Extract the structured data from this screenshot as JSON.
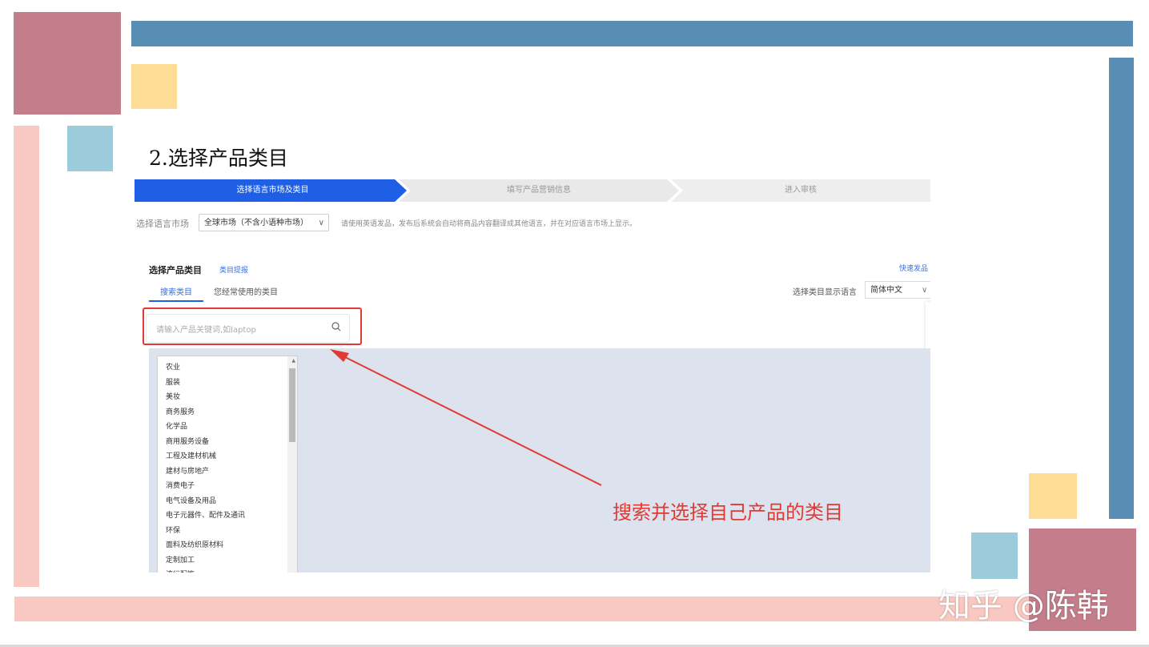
{
  "slide": {
    "heading": "2.选择产品类目",
    "annotation": "搜索并选择自己产品的类目",
    "watermark": "知乎 @陈韩"
  },
  "colors": {
    "rose": "#c47d8b",
    "steel_blue": "#588db4",
    "light_yellow": "#fddc95",
    "light_blue": "#9ccbdc",
    "light_pink": "#f9c8c1",
    "accent_red": "#e03a32",
    "primary_blue": "#1f5fe6",
    "category_area_bg": "#dde3ee"
  },
  "app": {
    "steps": [
      "选择语言市场及类目",
      "填写产品营销信息",
      "进入审核"
    ],
    "language_market": {
      "label": "选择语言市场",
      "selected": "全球市场（不含小语种市场）",
      "note": "请使用英语发品，发布后系统会自动将商品内容翻译成其他语言，并在对应语言市场上显示。"
    },
    "category_section": {
      "title": "选择产品类目",
      "report_link": "类目提报",
      "quick_link": "快速发品",
      "tabs": [
        "搜索类目",
        "您经常使用的类目"
      ],
      "display_language_label": "选择类目显示语言",
      "display_language_value": "简体中文"
    },
    "search": {
      "placeholder": "请输入产品关键词,如laptop",
      "icon": "search-icon"
    },
    "categories": [
      "农业",
      "服装",
      "美妆",
      "商务服务",
      "化学品",
      "商用服务设备",
      "工程及建材机械",
      "建材与房地产",
      "消费电子",
      "电气设备及用品",
      "电子元器件、配件及通讯",
      "环保",
      "面料及纺织原材料",
      "定制加工",
      "流行配饰"
    ]
  }
}
